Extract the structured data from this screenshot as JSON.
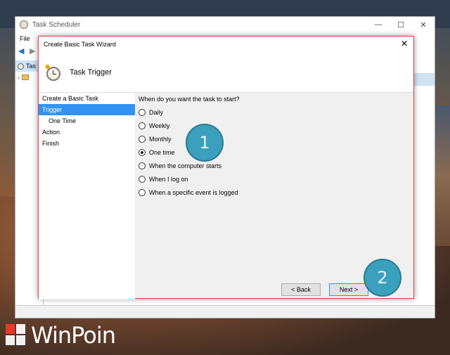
{
  "main_window": {
    "title": "Task Scheduler",
    "controls": [
      "—",
      "☐",
      "✕"
    ],
    "menu": [
      "File"
    ],
    "tree": [
      {
        "label": "Tas",
        "selected": true
      },
      {
        "label": "",
        "selected": false
      }
    ]
  },
  "wizard": {
    "title": "Create Basic Task Wizard",
    "close_glyph": "✕",
    "header_title": "Task Trigger",
    "steps": [
      {
        "label": "Create a Basic Task",
        "active": false,
        "sub": false
      },
      {
        "label": "Trigger",
        "active": true,
        "sub": false
      },
      {
        "label": "One Time",
        "active": false,
        "sub": true
      },
      {
        "label": "Action",
        "active": false,
        "sub": false
      },
      {
        "label": "Finish",
        "active": false,
        "sub": false
      }
    ],
    "question": "When do you want the task to start?",
    "options": [
      {
        "label": "Daily",
        "checked": false
      },
      {
        "label": "Weekly",
        "checked": false
      },
      {
        "label": "Monthly",
        "checked": false
      },
      {
        "label": "One time",
        "checked": true
      },
      {
        "label": "When the computer starts",
        "checked": false
      },
      {
        "label": "When I log on",
        "checked": false
      },
      {
        "label": "When a specific event is logged",
        "checked": false
      }
    ],
    "buttons": {
      "back": "< Back",
      "next": "Next >"
    }
  },
  "annotations": {
    "badge1": "1",
    "badge2": "2"
  },
  "branding": {
    "logo_text": "WinPoin"
  },
  "colors": {
    "accent": "#3392f2",
    "badge": "#3aa0bd",
    "dialog_border": "#e04050"
  }
}
